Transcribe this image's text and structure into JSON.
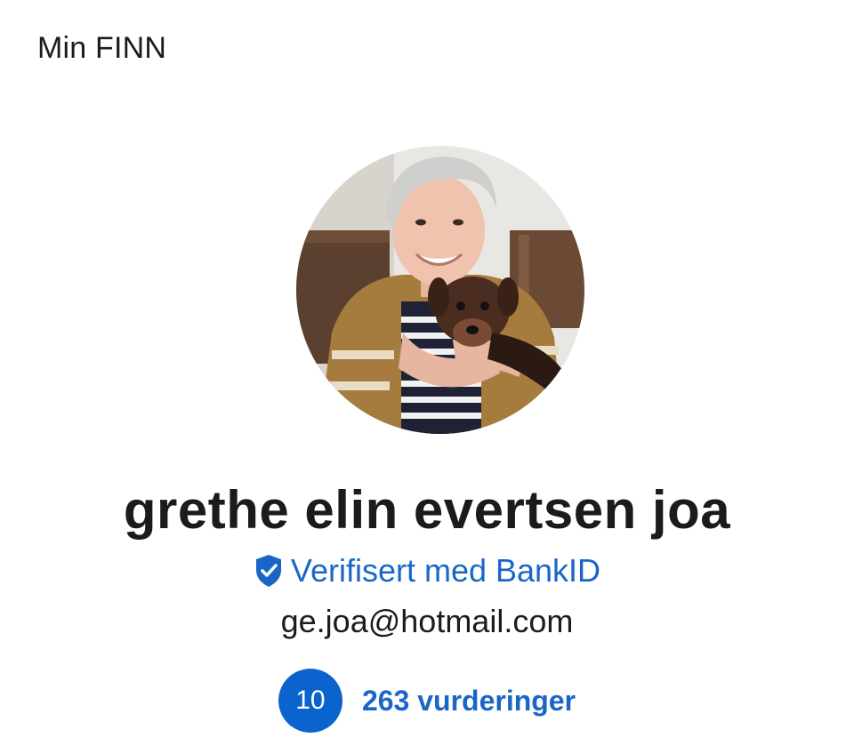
{
  "header": {
    "title": "Min FINN"
  },
  "profile": {
    "avatar_alt": "profile photo",
    "name": "grethe elin evertsen joa",
    "verification": {
      "label": "Verifisert med BankID",
      "icon": "shield-check-icon",
      "color": "#1a66c7"
    },
    "email": "ge.joa@hotmail.com"
  },
  "rating": {
    "score": "10",
    "reviews_label": "263 vurderinger",
    "badge_color": "#0b63ce"
  }
}
